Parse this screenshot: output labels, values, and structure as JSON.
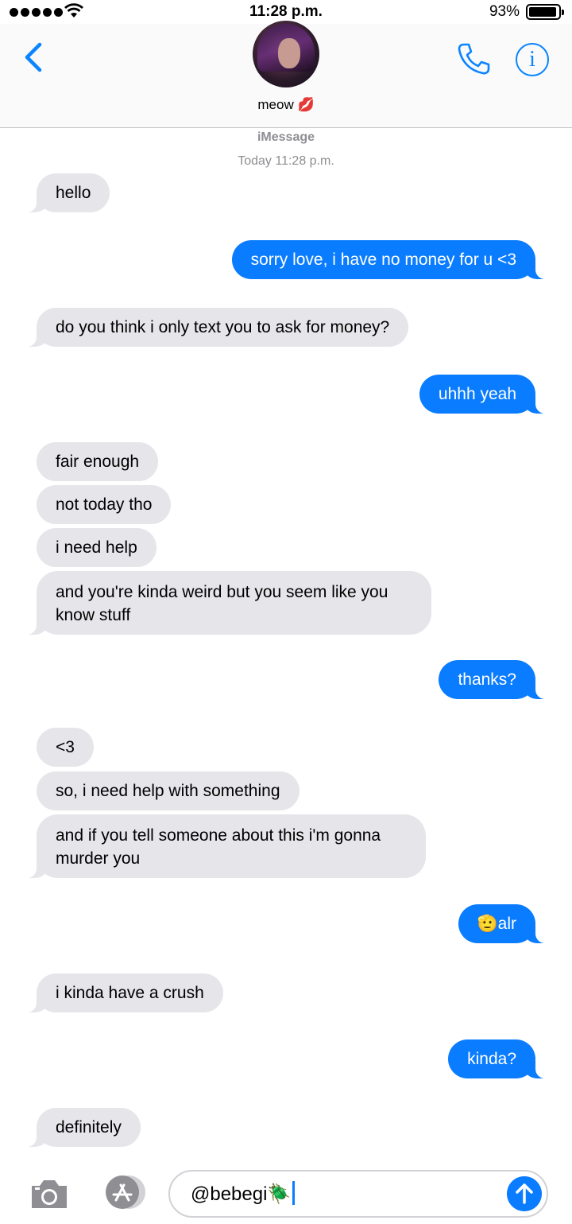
{
  "status_bar": {
    "time": "11:28 p.m.",
    "battery_percent": "93%",
    "battery_level": 0.93,
    "signal_bars": 5,
    "icons": [
      "signal-dots-icon",
      "wifi-icon",
      "battery-icon"
    ]
  },
  "header": {
    "contact_name": "meow 💋",
    "icons": [
      "chevron-left-icon",
      "avatar",
      "phone-icon",
      "info-icon"
    ]
  },
  "conversation": {
    "service": "iMessage",
    "date": "Today 11:28 p.m.",
    "messages": [
      {
        "from": "them",
        "text": "hello"
      },
      {
        "from": "me",
        "text": "sorry love, i have no money for u <3"
      },
      {
        "from": "them",
        "text": "do you think i only text you to ask for money?"
      },
      {
        "from": "me",
        "text": "uhhh yeah"
      },
      {
        "from": "them",
        "text": "fair enough"
      },
      {
        "from": "them",
        "text": "not today tho"
      },
      {
        "from": "them",
        "text": "i need help"
      },
      {
        "from": "them",
        "text": "and you're kinda weird but you seem like you know stuff"
      },
      {
        "from": "me",
        "text": "thanks?"
      },
      {
        "from": "them",
        "text": "<3"
      },
      {
        "from": "them",
        "text": "so, i need help with something"
      },
      {
        "from": "them",
        "text": "and if you tell someone about this i'm gonna murder you"
      },
      {
        "from": "me",
        "text": "🫡alr"
      },
      {
        "from": "them",
        "text": "i kinda have a crush"
      },
      {
        "from": "me",
        "text": "kinda?"
      },
      {
        "from": "them",
        "text": "definitely"
      }
    ]
  },
  "composer": {
    "text": "@bebegi🪲",
    "icons": [
      "camera-icon",
      "app-store-icon",
      "send-arrow-icon"
    ]
  },
  "colors": {
    "accent": "#0a7cff",
    "incoming_bubble": "#e5e5ea",
    "meta_text": "#8e8e93"
  }
}
